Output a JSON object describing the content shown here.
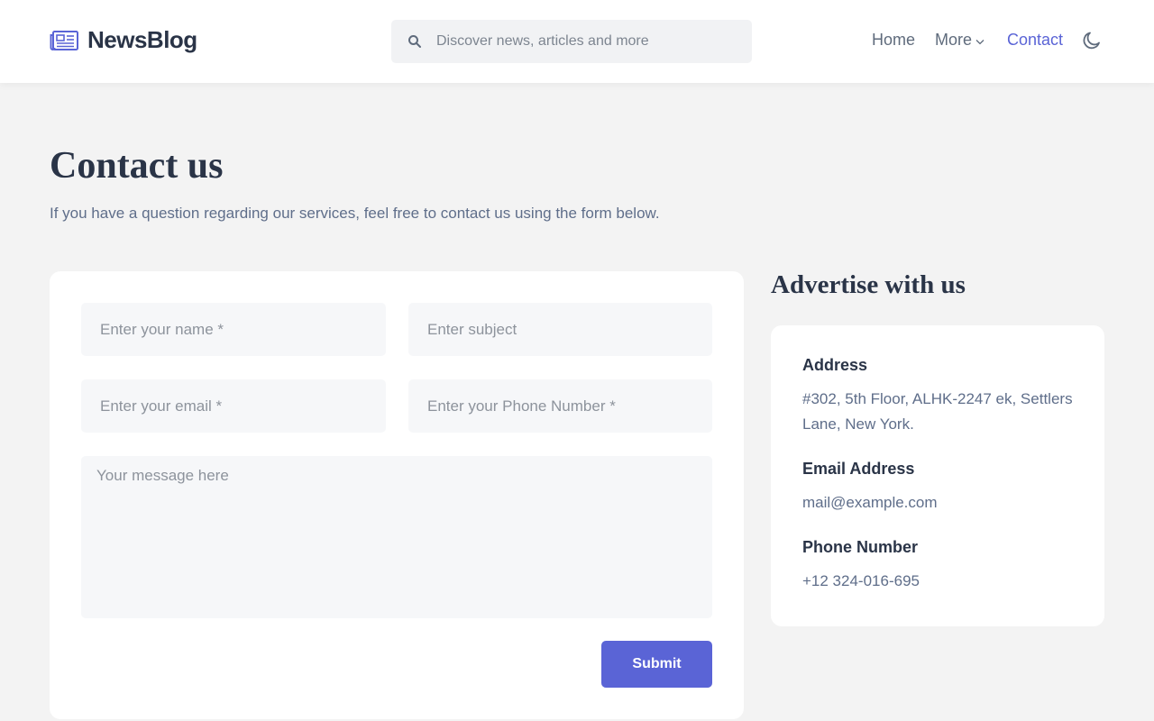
{
  "header": {
    "brand": "NewsBlog",
    "search_placeholder": "Discover news, articles and more",
    "nav": {
      "home": "Home",
      "more": "More",
      "contact": "Contact"
    }
  },
  "page": {
    "title": "Contact us",
    "subtitle": "If you have a question regarding our services, feel free to contact us using the form below."
  },
  "form": {
    "name_placeholder": "Enter your name *",
    "subject_placeholder": "Enter subject",
    "email_placeholder": "Enter your email *",
    "phone_placeholder": "Enter your Phone Number *",
    "message_placeholder": "Your message here",
    "submit_label": "Submit"
  },
  "advertise": {
    "title": "Advertise with us",
    "address_label": "Address",
    "address_value": "#302, 5th Floor, ALHK-2247 ek, Settlers Lane, New York.",
    "email_label": "Email Address",
    "email_value": "mail@example.com",
    "phone_label": "Phone Number",
    "phone_value": "+12 324-016-695"
  },
  "colors": {
    "accent": "#5a64d6",
    "heading": "#2a3447",
    "muted_text": "#5f6e8a",
    "page_background": "#f3f3f3"
  },
  "icons": {
    "logo": "newspaper-icon",
    "search": "search-icon",
    "more": "chevron-down-icon",
    "theme": "moon-icon"
  }
}
